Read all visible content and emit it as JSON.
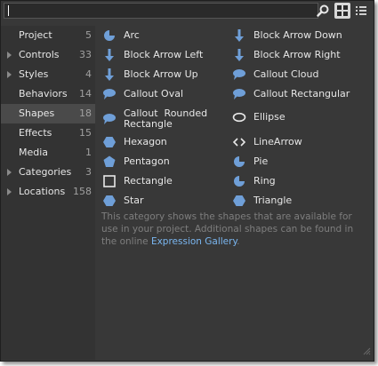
{
  "search": {
    "value": "",
    "placeholder": ""
  },
  "toolbar": {
    "search_icon": "magnifier-icon",
    "grid_view_icon": "grid-view-icon",
    "list_view_icon": "list-view-icon"
  },
  "sidebar": {
    "items": [
      {
        "label": "Project",
        "count": "5",
        "expandable": false
      },
      {
        "label": "Controls",
        "count": "33",
        "expandable": true
      },
      {
        "label": "Styles",
        "count": "4",
        "expandable": true
      },
      {
        "label": "Behaviors",
        "count": "14",
        "expandable": false
      },
      {
        "label": "Shapes",
        "count": "18",
        "expandable": false,
        "selected": true
      },
      {
        "label": "Effects",
        "count": "15",
        "expandable": false
      },
      {
        "label": "Media",
        "count": "1",
        "expandable": false
      },
      {
        "label": "Categories",
        "count": "3",
        "expandable": true
      },
      {
        "label": "Locations",
        "count": "158",
        "expandable": true
      }
    ]
  },
  "shapes": {
    "left": [
      {
        "label": "Arc",
        "icon": "arc-icon"
      },
      {
        "label": "Block Arrow Left",
        "icon": "block-arrow-left-icon"
      },
      {
        "label": "Block Arrow Up",
        "icon": "block-arrow-up-icon"
      },
      {
        "label": "Callout Oval",
        "icon": "callout-oval-icon"
      },
      {
        "label": "Callout  Rounded\nRectangle",
        "icon": "callout-rounded-rectangle-icon"
      },
      {
        "label": "Hexagon",
        "icon": "hexagon-icon"
      },
      {
        "label": "Pentagon",
        "icon": "pentagon-icon"
      },
      {
        "label": "Rectangle",
        "icon": "rectangle-icon"
      },
      {
        "label": "Star",
        "icon": "star-icon"
      }
    ],
    "right": [
      {
        "label": "Block Arrow Down",
        "icon": "block-arrow-down-icon"
      },
      {
        "label": "Block Arrow Right",
        "icon": "block-arrow-right-icon"
      },
      {
        "label": "Callout Cloud",
        "icon": "callout-cloud-icon"
      },
      {
        "label": "Callout Rectangular",
        "icon": "callout-rectangular-icon"
      },
      {
        "label": "Ellipse",
        "icon": "ellipse-icon"
      },
      {
        "label": "LineArrow",
        "icon": "line-arrow-icon"
      },
      {
        "label": "Pie",
        "icon": "pie-icon"
      },
      {
        "label": "Ring",
        "icon": "ring-icon"
      },
      {
        "label": "Triangle",
        "icon": "triangle-icon"
      }
    ]
  },
  "description": {
    "text": "This category shows the shapes that are available for use in your project. Additional shapes can be found in the online ",
    "link": "Expression Gallery",
    "suffix": "."
  },
  "colors": {
    "icon_blue": "#6f9fd8",
    "link": "#7ab6f0",
    "panel_bg": "#383838",
    "sidebar_bg": "#333333",
    "selected_bg": "#4a4a4a"
  }
}
